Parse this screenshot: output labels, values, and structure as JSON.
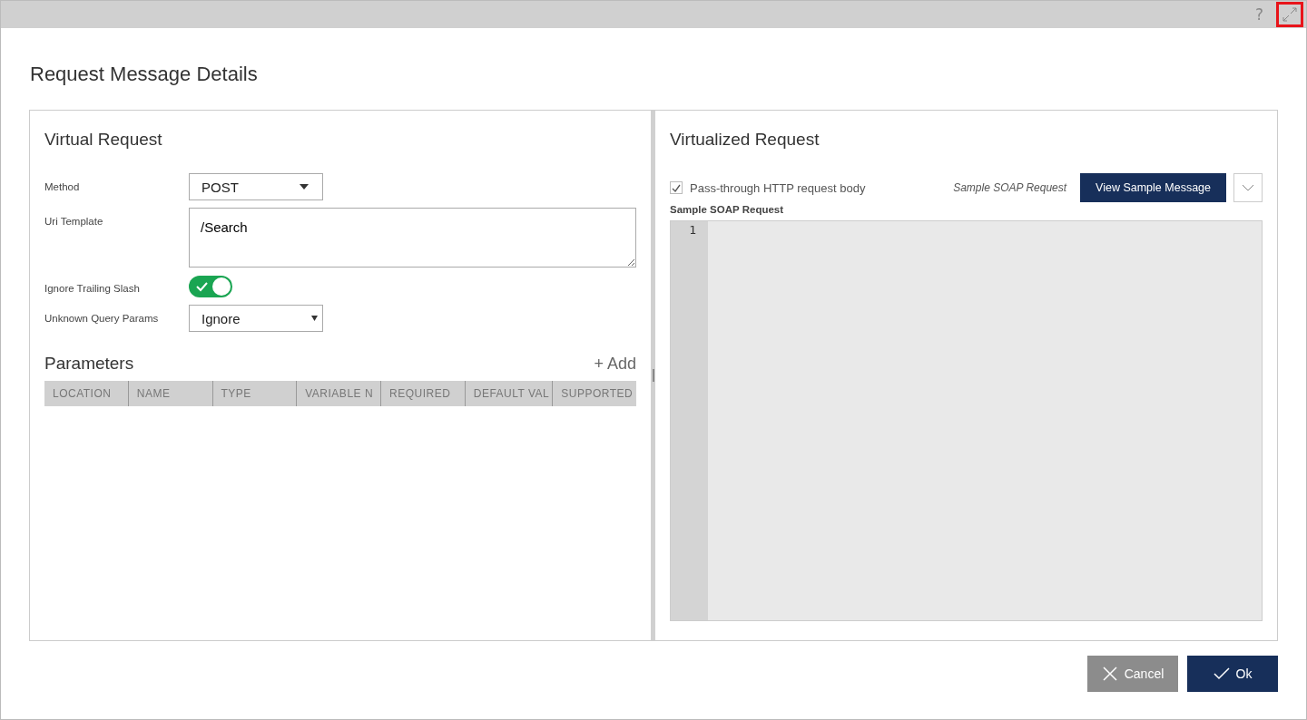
{
  "window": {
    "help": "?",
    "expand_highlighted": true
  },
  "title": "Request Message Details",
  "virtual_request": {
    "heading": "Virtual Request",
    "fields": [
      {
        "kind": "select",
        "label": "Method",
        "value": "POST"
      },
      {
        "kind": "textarea",
        "label": "Uri Template",
        "value": "/Search"
      },
      {
        "kind": "toggle",
        "label": "Ignore Trailing Slash",
        "on": true
      },
      {
        "kind": "native-select",
        "label": "Unknown Query Params",
        "value": "Ignore"
      }
    ],
    "parameters": {
      "heading": "Parameters",
      "add": "+ Add",
      "columns": [
        "LOCATION",
        "NAME",
        "TYPE",
        "VARIABLE N",
        "REQUIRED",
        "DEFAULT VAL",
        "SUPPORTED"
      ]
    }
  },
  "virtualized_request": {
    "heading": "Virtualized Request",
    "passthrough": {
      "label": "Pass-through HTTP request body",
      "checked": true
    },
    "sample_hint": "Sample SOAP Request",
    "view_button": "View Sample Message",
    "editor_label": "Sample SOAP Request",
    "line_numbers": [
      "1"
    ]
  },
  "buttons": [
    {
      "kind": "cancel",
      "label": "Cancel"
    },
    {
      "kind": "ok",
      "label": "Ok"
    }
  ]
}
